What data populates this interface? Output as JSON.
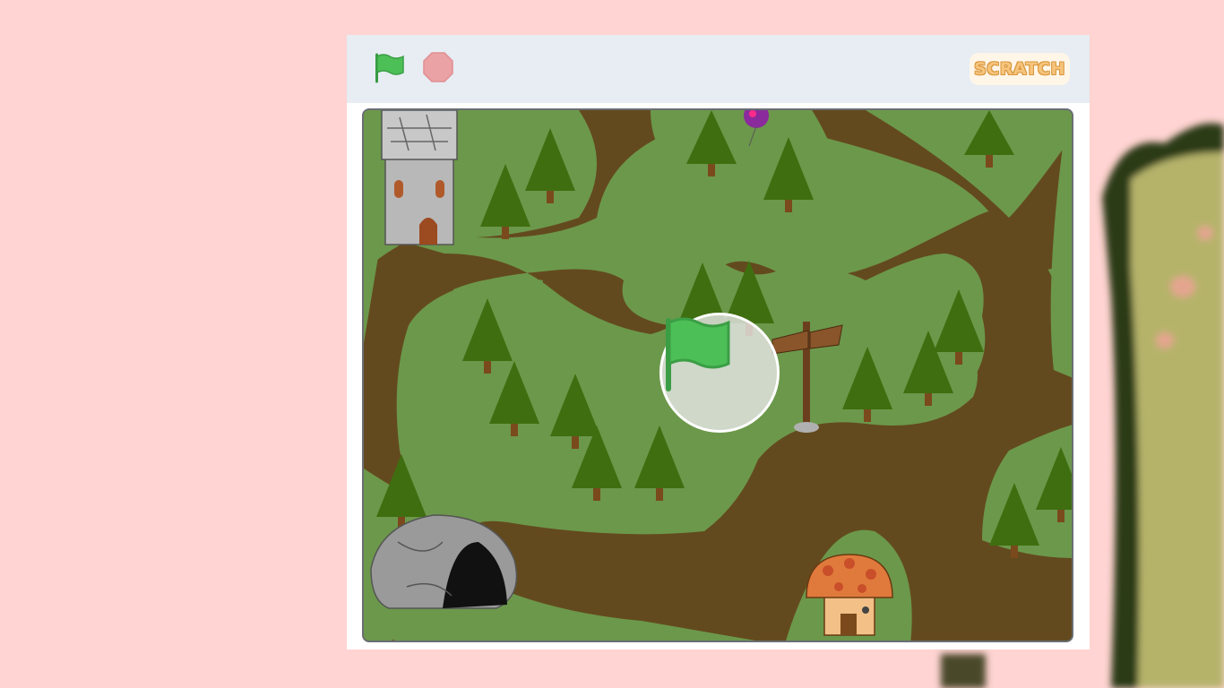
{
  "player": {
    "logo_text": "SCRATCH",
    "green_flag_icon": "green-flag-icon",
    "stop_icon": "stop-sign-icon"
  },
  "colors": {
    "page_background": "#ffd4d2",
    "control_bar": "#e7edf3",
    "flag_green": "#4cbf56",
    "stop_red": "#eba2a4",
    "grass": "#6c984b",
    "path": "#634a1e",
    "tree": "#3f6e10",
    "trunk": "#7a4a1c"
  },
  "stage": {
    "scene": "forest-maze",
    "sprites": [
      "tower",
      "cave",
      "mushroom-house",
      "signpost",
      "balloon",
      "trees"
    ]
  }
}
